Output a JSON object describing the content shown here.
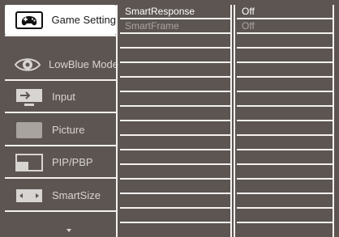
{
  "menu": {
    "items": [
      {
        "label": "Game Setting",
        "icon": "gamepad-icon",
        "active": true
      },
      {
        "label": "LowBlue Mode",
        "icon": "eye-icon",
        "active": false
      },
      {
        "label": "Input",
        "icon": "input-icon",
        "active": false
      },
      {
        "label": "Picture",
        "icon": "picture-icon",
        "active": false
      },
      {
        "label": "PIP/PBP",
        "icon": "pip-icon",
        "active": false
      },
      {
        "label": "SmartSize",
        "icon": "smartsize-icon",
        "active": false
      }
    ],
    "more_indicator": "chevron-down-icon"
  },
  "submenu": {
    "items": [
      {
        "label": "SmartResponse",
        "state": "selected"
      },
      {
        "label": "SmartFrame",
        "state": "disabled"
      },
      {
        "label": ""
      },
      {
        "label": ""
      },
      {
        "label": ""
      },
      {
        "label": ""
      },
      {
        "label": ""
      },
      {
        "label": ""
      },
      {
        "label": ""
      },
      {
        "label": ""
      },
      {
        "label": ""
      },
      {
        "label": ""
      },
      {
        "label": ""
      },
      {
        "label": ""
      },
      {
        "label": ""
      }
    ]
  },
  "values": {
    "items": [
      {
        "label": "Off",
        "state": "selected"
      },
      {
        "label": "Off",
        "state": "disabled"
      },
      {
        "label": ""
      },
      {
        "label": ""
      },
      {
        "label": ""
      },
      {
        "label": ""
      },
      {
        "label": ""
      },
      {
        "label": ""
      },
      {
        "label": ""
      },
      {
        "label": ""
      },
      {
        "label": ""
      },
      {
        "label": ""
      },
      {
        "label": ""
      },
      {
        "label": ""
      },
      {
        "label": ""
      }
    ]
  },
  "colors": {
    "background": "#5d5552",
    "lines": "#f3f1f0",
    "active_bg": "#ffffff",
    "text": "#d8d4d2",
    "dim_text": "#a9a3a0"
  }
}
